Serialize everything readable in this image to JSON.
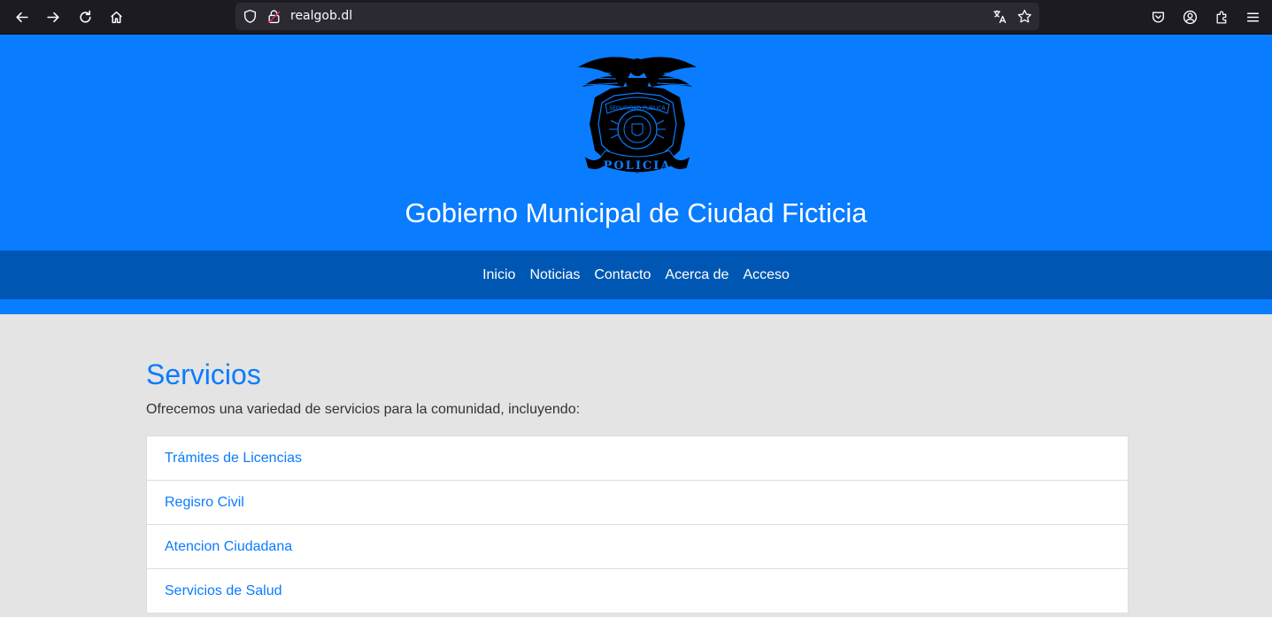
{
  "browser": {
    "url": "realgob.dl"
  },
  "header": {
    "title": "Gobierno Municipal de Ciudad Ficticia",
    "emblem": {
      "top_text": "SEGURIDAD PUBLICA",
      "banner_text": "POLICIA"
    }
  },
  "nav": {
    "items": [
      {
        "label": "Inicio"
      },
      {
        "label": "Noticias"
      },
      {
        "label": "Contacto"
      },
      {
        "label": "Acerca de"
      },
      {
        "label": "Acceso"
      }
    ]
  },
  "services": {
    "title": "Servicios",
    "intro": "Ofrecemos una variedad de servicios para la comunidad, incluyendo:",
    "items": [
      {
        "label": "Trámites de Licencias"
      },
      {
        "label": "Regisro Civil"
      },
      {
        "label": "Atencion Ciudadana"
      },
      {
        "label": "Servicios de Salud"
      }
    ]
  },
  "colors": {
    "header_bg": "#0a7cff",
    "nav_bg": "#0057b3",
    "page_bg": "#e4e4e4",
    "link": "#0a7cff",
    "browser_chrome": "#1c1b22"
  }
}
